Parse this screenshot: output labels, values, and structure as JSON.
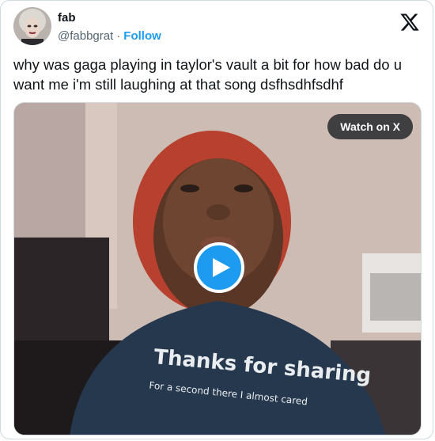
{
  "author": {
    "name": "fab",
    "handle": "@fabbgrat",
    "separator": "·",
    "follow_label": "Follow"
  },
  "icons": {
    "platform": "x-logo-icon",
    "play": "play-icon"
  },
  "tweet": {
    "text": "why was gaga playing in taylor's vault a bit for how bad do u want me i'm still laughing at that song dsfhsdhfsdhf"
  },
  "media": {
    "watch_label": "Watch on X",
    "shirt_line1": "Thanks for sharing",
    "shirt_line2": "For a second there I almost cared"
  },
  "colors": {
    "accent": "#1d9bf0",
    "text": "#0f1419",
    "secondary": "#536471",
    "border": "#cfd9de"
  }
}
